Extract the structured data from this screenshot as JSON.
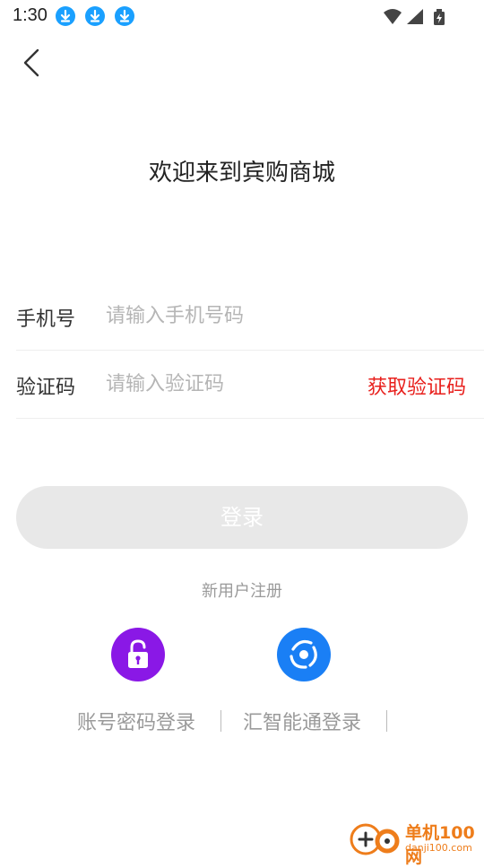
{
  "status_bar": {
    "time": "1:30",
    "notification_icons": [
      "download-icon",
      "download-icon",
      "download-icon"
    ],
    "system_icons": [
      "wifi-icon",
      "signal-icon",
      "battery-charging-icon"
    ]
  },
  "header": {
    "back_icon": "chevron-left-icon"
  },
  "title": "欢迎来到宾购商城",
  "form": {
    "phone": {
      "label": "手机号",
      "placeholder": "请输入手机号码",
      "value": ""
    },
    "code": {
      "label": "验证码",
      "placeholder": "请输入验证码",
      "value": "",
      "get_code_label": "获取验证码"
    }
  },
  "login_button": {
    "label": "登录"
  },
  "register_link": "新用户注册",
  "alt_logins": [
    {
      "label": "账号密码登录",
      "icon": "unlock-icon",
      "color": "#8a18e6"
    },
    {
      "label": "汇智能通登录",
      "icon": "hzn-logo-icon",
      "color": "#1a7ff5"
    }
  ],
  "watermark": {
    "title": "单机100网",
    "url": "danji100.com"
  },
  "colors": {
    "accent_red": "#e8201d",
    "button_disabled": "#e8e8e8",
    "download_blue": "#1aa0ff",
    "watermark_orange": "#ee7d1b"
  }
}
